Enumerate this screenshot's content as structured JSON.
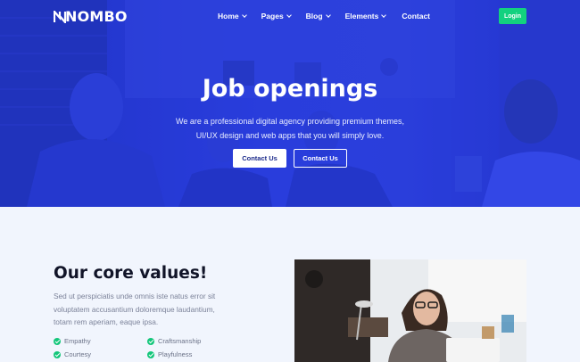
{
  "brand": {
    "logo": "NOMBO"
  },
  "nav": {
    "items": [
      {
        "label": "Home",
        "has_dropdown": true
      },
      {
        "label": "Pages",
        "has_dropdown": true
      },
      {
        "label": "Blog",
        "has_dropdown": true
      },
      {
        "label": "Elements",
        "has_dropdown": true
      },
      {
        "label": "Contact",
        "has_dropdown": false
      }
    ],
    "login_label": "Login"
  },
  "hero": {
    "title": "Job openings",
    "subtitle": "We are a professional digital agency providing premium themes, UI/UX design and web apps that you will simply love.",
    "primary_button": "Contact Us",
    "secondary_button": "Contact Us"
  },
  "values": {
    "title": "Our core values!",
    "text": "Sed ut perspiciatis unde omnis iste natus error sit voluptatem accusantium doloremque laudantium, totam rem aperiam, eaque ipsa.",
    "items": [
      "Empathy",
      "Craftsmanship",
      "Courtesy",
      "Playfulness"
    ]
  },
  "colors": {
    "hero_blue": "#2b3fd6",
    "accent_green": "#13d17f",
    "section_bg": "#f1f5fd",
    "heading": "#111428"
  }
}
